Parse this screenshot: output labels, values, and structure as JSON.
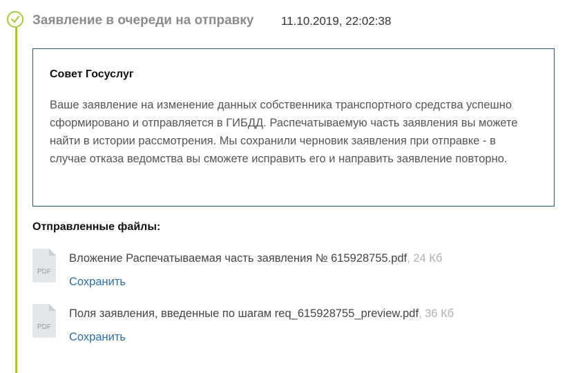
{
  "status": {
    "title": "Заявление в очереди на отправку",
    "datetime": "11.10.2019, 22:02:38",
    "icon": "check-circle-icon",
    "accent_color": "#a7c83b"
  },
  "advice": {
    "title": "Совет Госуслуг",
    "text": "Ваше заявление на изменение данных собственника транспортного средства успешно сформировано и отправляется в ГИБДД. Распечатываемую часть заявления вы можете найти в истории рассмотрения. Мы сохранили черновик заявления при отправке - в случае отказа ведомства вы сможете исправить его и направить заявление повторно.",
    "border_color": "#1d5b8d"
  },
  "files": {
    "title": "Отправленные файлы:",
    "items": [
      {
        "icon": "pdf-file-icon",
        "icon_label": "PDF",
        "name": "Вложение Распечатываемая часть заявления № 615928755.pdf",
        "size": ", 24 Кб",
        "action": "Сохранить"
      },
      {
        "icon": "pdf-file-icon",
        "icon_label": "PDF",
        "name": "Поля заявления, введенные по шагам req_615928755_preview.pdf",
        "size": ", 36 Кб",
        "action": "Сохранить"
      }
    ],
    "link_color": "#2a6fa8"
  }
}
